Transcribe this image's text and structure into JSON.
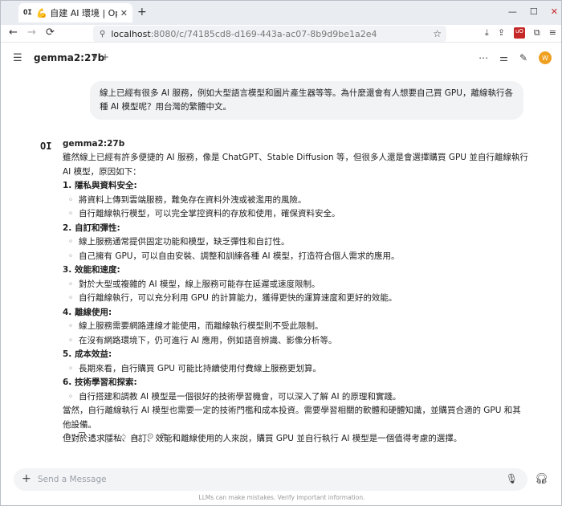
{
  "browser": {
    "tab": {
      "favicon": "OI",
      "title": "💪 自建 AI 環境 | Open",
      "close": "✕"
    },
    "new_tab": "+",
    "window_controls": {
      "minimize": "—",
      "maximize": "☐",
      "close": "✕"
    },
    "nav": {
      "back": "←",
      "forward": "→",
      "reload": "⟳"
    },
    "url": {
      "host": "localhost",
      "path": ":8080/c/74185cd8-d169-443a-ac07-8b9d9be1a2e4"
    },
    "ext_ublock": "uO"
  },
  "header": {
    "model": "gemma2:27b",
    "plus": "+",
    "avatar": "W"
  },
  "user_message": "線上已經有很多 AI 服務，例如大型語言模型和圖片產生器等等。為什麼還會有人想要自己買 GPU，離線執行各種 AI 模型呢？用台灣的繁體中文。",
  "assistant": {
    "avatar": "OI",
    "model": "gemma2:27b",
    "intro": "雖然線上已經有許多便捷的 AI 服務，像是 ChatGPT、Stable Diffusion 等，但很多人還是會選擇購買 GPU 並自行離線執行 AI 模型，原因如下：",
    "sections": [
      {
        "heading": "1. 隱私與資料安全:",
        "items": [
          "將資料上傳到雲端服務，難免存在資料外洩或被濫用的風險。",
          "自行離線執行模型，可以完全掌控資料的存放和使用，確保資料安全。"
        ]
      },
      {
        "heading": "2. 自訂和彈性:",
        "items": [
          "線上服務通常提供固定功能和模型，缺乏彈性和自訂性。",
          "自己擁有 GPU，可以自由安裝、調整和訓練各種 AI 模型，打造符合個人需求的應用。"
        ]
      },
      {
        "heading": "3. 效能和速度:",
        "items": [
          "對於大型或複雜的 AI 模型，線上服務可能存在延遲或速度限制。",
          "自行離線執行，可以充分利用 GPU 的計算能力，獲得更快的運算速度和更好的效能。"
        ]
      },
      {
        "heading": "4. 離線使用:",
        "items": [
          "線上服務需要網路連線才能使用，而離線執行模型則不受此限制。",
          "在沒有網路環境下，仍可進行 AI 應用，例如語音辨識、影像分析等。"
        ]
      },
      {
        "heading": "5. 成本效益:",
        "items": [
          "長期來看，自行購買 GPU 可能比持續使用付費線上服務更划算。"
        ]
      },
      {
        "heading": "6. 技術學習和探索:",
        "items": [
          "自行搭建和調教 AI 模型是一個很好的技術學習機會，可以深入了解 AI 的原理和實踐。"
        ]
      }
    ],
    "outro1": "當然，自行離線執行 AI 模型也需要一定的技術門檻和成本投資。需要學習相關的軟體和硬體知識，並購買合適的 GPU 和其他設備。",
    "outro2": "但對於追求隱私、自訂、效能和離線使用的人來說，購買 GPU 並自行執行 AI 模型是一個值得考慮的選擇。"
  },
  "input": {
    "placeholder": "Send a Message"
  },
  "disclaimer": "LLMs can make mistakes. Verify important information."
}
